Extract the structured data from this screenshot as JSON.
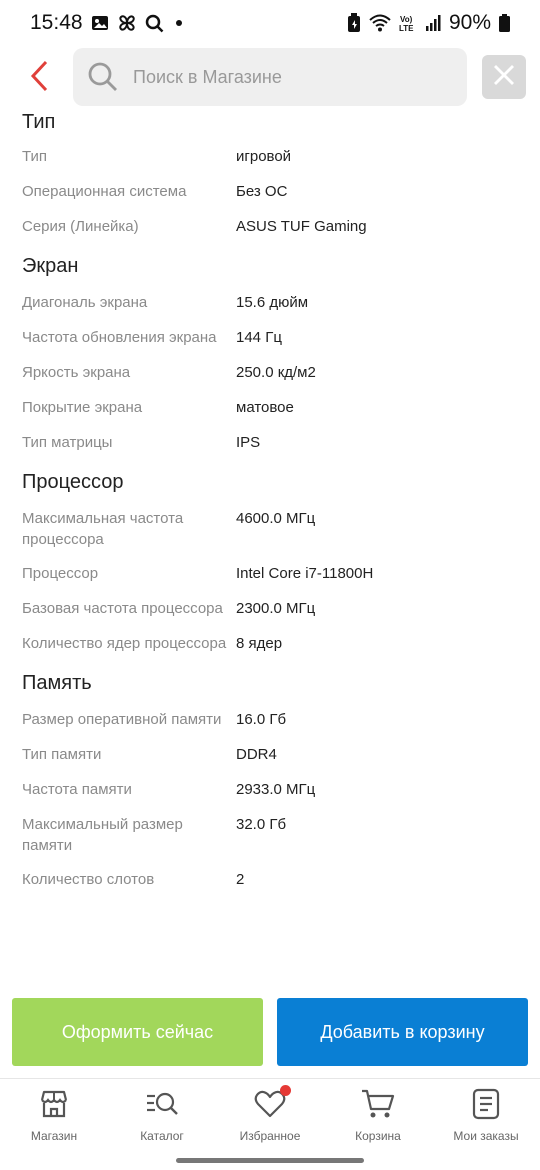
{
  "status_bar": {
    "time": "15:48",
    "battery": "90%",
    "icons_left": [
      "image-icon",
      "pinwheel-icon",
      "search-icon",
      "notification-dot"
    ],
    "icons_right": [
      "battery-saver-icon",
      "wifi-icon",
      "volte-icon",
      "signal-icon",
      "battery-icon"
    ]
  },
  "header": {
    "search_placeholder": "Поиск в Магазине",
    "accent_color": "#e0403a"
  },
  "specs": [
    {
      "title": "Тип",
      "rows": [
        {
          "label": "Тип",
          "value": "игровой"
        },
        {
          "label": "Операционная система",
          "value": "Без ОС"
        },
        {
          "label": "Серия (Линейка)",
          "value": "ASUS TUF Gaming"
        }
      ]
    },
    {
      "title": "Экран",
      "rows": [
        {
          "label": "Диагональ экрана",
          "value": "15.6 дюйм"
        },
        {
          "label": "Частота обновления экрана",
          "value": "144 Гц"
        },
        {
          "label": "Яркость экрана",
          "value": "250.0 кд/м2"
        },
        {
          "label": "Покрытие экрана",
          "value": "матовое"
        },
        {
          "label": "Тип матрицы",
          "value": "IPS"
        }
      ]
    },
    {
      "title": "Процессор",
      "rows": [
        {
          "label": "Максимальная частота процессора",
          "value": "4600.0 МГц"
        },
        {
          "label": "Процессор",
          "value": "Intel Core i7-11800H"
        },
        {
          "label": "Базовая частота процессора",
          "value": "2300.0 МГц"
        },
        {
          "label": "Количество ядер процессора",
          "value": "8 ядер"
        }
      ]
    },
    {
      "title": "Память",
      "rows": [
        {
          "label": "Размер оперативной памяти",
          "value": "16.0 Гб"
        },
        {
          "label": "Тип памяти",
          "value": "DDR4"
        },
        {
          "label": "Частота памяти",
          "value": "2933.0 МГц"
        },
        {
          "label": "Максимальный размер памяти",
          "value": "32.0 Гб"
        },
        {
          "label": "Количество слотов",
          "value": "2"
        }
      ]
    }
  ],
  "actions": {
    "buy_now": "Оформить сейчас",
    "add_to_cart": "Добавить в корзину",
    "buy_color": "#a2d75b",
    "cart_color": "#0a7fd4"
  },
  "bottom_nav": [
    {
      "label": "Магазин",
      "icon": "store-icon"
    },
    {
      "label": "Каталог",
      "icon": "catalog-search-icon"
    },
    {
      "label": "Избранное",
      "icon": "heart-icon",
      "badge": true
    },
    {
      "label": "Корзина",
      "icon": "cart-icon"
    },
    {
      "label": "Мои заказы",
      "icon": "orders-icon"
    }
  ]
}
